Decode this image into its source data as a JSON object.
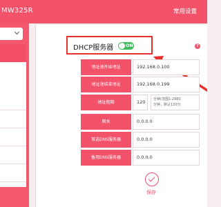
{
  "header": {
    "model": "MW325R",
    "common_settings": "常用设置"
  },
  "dhcp": {
    "label": "DHCP服务器",
    "toggle_text": "ON"
  },
  "form": {
    "start_address_label": "地址池开始地址",
    "start_address_value": "192.168.0.100",
    "end_address_label": "地址池结束地址",
    "end_address_value": "192.168.0.199",
    "lease_label": "地址租期",
    "lease_value": "120",
    "lease_hint_line1": "分钟(范围1-2880",
    "lease_hint_line2": "分钟，默认120分",
    "gateway_label": "网关",
    "gateway_value": "0.0.0.0",
    "primary_dns_label": "首选DNS服务器",
    "primary_dns_value": "0.0.0.0",
    "secondary_dns_label": "备用DNS服务器",
    "secondary_dns_value": "0.0.0.0"
  },
  "save_label": "保存",
  "colors": {
    "brand": "#f2526a",
    "annotation": "#e7312c",
    "toggle_on": "#3fbe5c"
  },
  "icons": [
    "chevron-down-icon",
    "help-icon",
    "save-check-icon",
    "annotation-arrow"
  ]
}
